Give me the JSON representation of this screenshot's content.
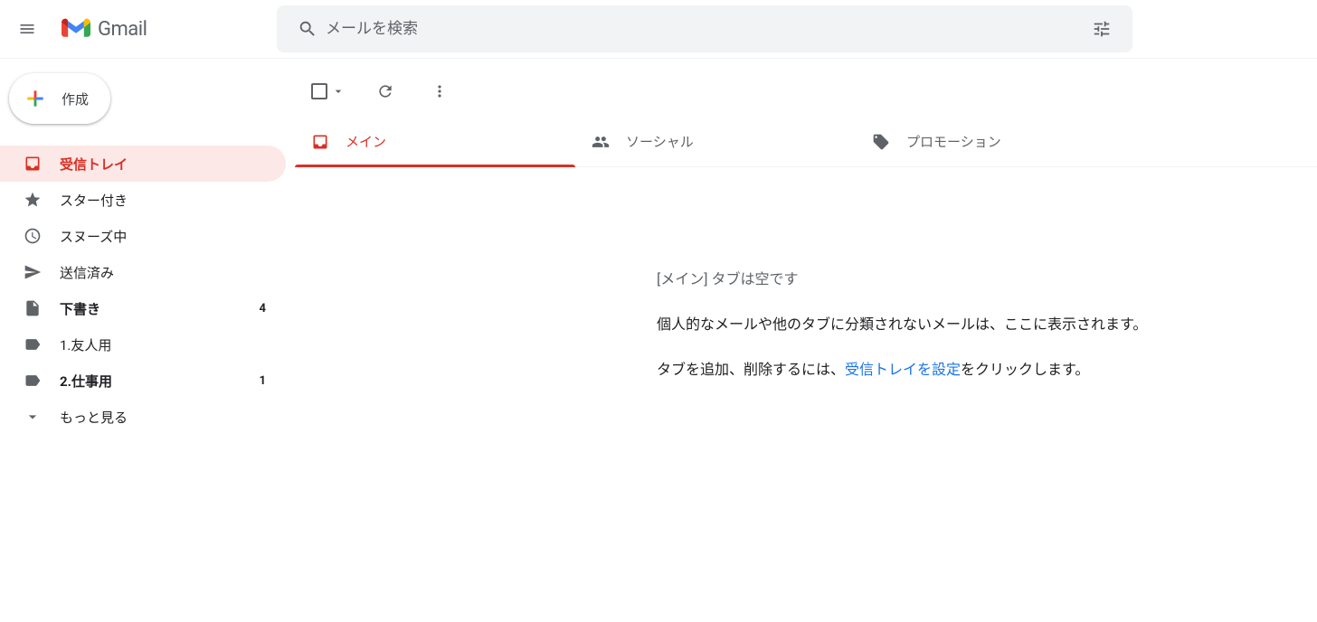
{
  "header": {
    "app_name": "Gmail",
    "search_placeholder": "メールを検索"
  },
  "sidebar": {
    "compose_label": "作成",
    "items": [
      {
        "label": "受信トレイ",
        "count": "",
        "active": true,
        "bold": false
      },
      {
        "label": "スター付き",
        "count": "",
        "active": false,
        "bold": false
      },
      {
        "label": "スヌーズ中",
        "count": "",
        "active": false,
        "bold": false
      },
      {
        "label": "送信済み",
        "count": "",
        "active": false,
        "bold": false
      },
      {
        "label": "下書き",
        "count": "4",
        "active": false,
        "bold": true
      },
      {
        "label": "1.友人用",
        "count": "",
        "active": false,
        "bold": false
      },
      {
        "label": "2.仕事用",
        "count": "1",
        "active": false,
        "bold": true
      },
      {
        "label": "もっと見る",
        "count": "",
        "active": false,
        "bold": false
      }
    ]
  },
  "tabs": [
    {
      "label": "メイン",
      "active": true
    },
    {
      "label": "ソーシャル",
      "active": false
    },
    {
      "label": "プロモーション",
      "active": false
    }
  ],
  "empty": {
    "title": "[メイン] タブは空です",
    "desc": "個人的なメールや他のタブに分類されないメールは、ここに表示されます。",
    "line2_pre": "タブを追加、削除するには、",
    "link": "受信トレイを設定",
    "line2_post": "をクリックします。"
  }
}
